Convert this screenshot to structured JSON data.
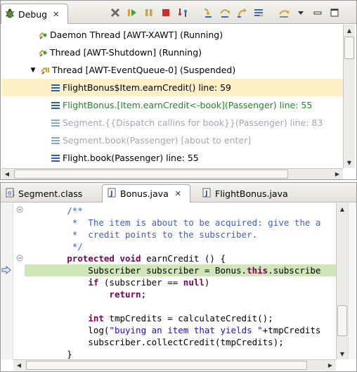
{
  "debug_view": {
    "tab_label": "Debug",
    "tree": [
      {
        "label": "Daemon Thread [AWT-XAWT] (Running)",
        "kind": "thread",
        "style": "normal"
      },
      {
        "label": "Thread [AWT-Shutdown] (Running)",
        "kind": "thread",
        "style": "normal"
      },
      {
        "label": "Thread [AWT-EventQueue-0] (Suspended)",
        "kind": "thread-suspended",
        "style": "normal"
      },
      {
        "label": "FlightBonus$Item.earnCredit() line: 59",
        "kind": "frame",
        "style": "normal",
        "selected": true
      },
      {
        "label": "FlightBonus.[Item.earnCredit<-book](Passenger) line: 55",
        "kind": "frame",
        "style": "green"
      },
      {
        "label": "Segment.{{Dispatch callins for book}}(Passenger) line: 83",
        "kind": "frame",
        "style": "grey"
      },
      {
        "label": "Segment.book(Passenger) [about to enter]",
        "kind": "frame",
        "style": "grey"
      },
      {
        "label": "Flight.book(Passenger) line: 55",
        "kind": "frame",
        "style": "normal"
      }
    ]
  },
  "editor": {
    "tabs": [
      {
        "label": "Segment.class",
        "active": false
      },
      {
        "label": "Bonus.java",
        "active": true
      },
      {
        "label": "FlightBonus.java",
        "active": false
      }
    ],
    "code_lines": [
      "        /**",
      "         *  The item is about to be acquired: give the a",
      "         *  credit points to the subscriber.",
      "         */",
      "        protected void earnCredit () {",
      "            Subscriber subscriber = Bonus.this.subscribe",
      "            if (subscriber == null)",
      "                return;",
      "",
      "            int tmpCredits = calculateCredit();",
      "            log(\"buying an item that yields \"+tmpCredits",
      "            subscriber.collectCredit(tmpCredits);",
      "        }"
    ]
  }
}
